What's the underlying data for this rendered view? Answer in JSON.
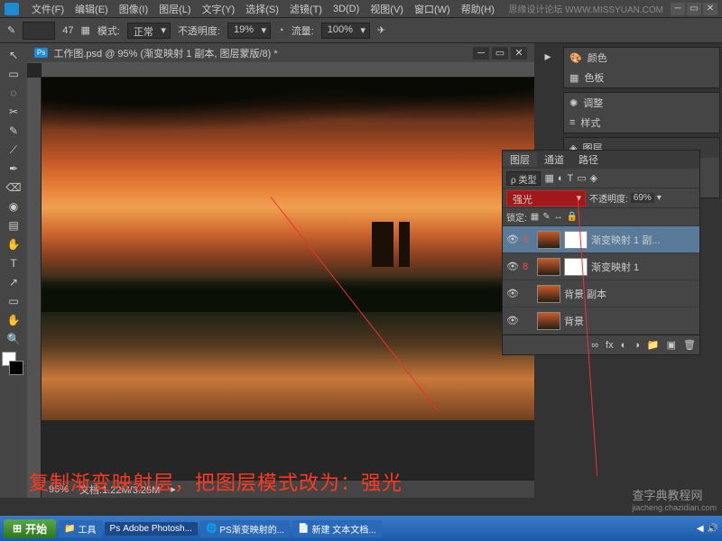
{
  "menubar": {
    "items": [
      "文件(F)",
      "编辑(E)",
      "图像(I)",
      "图层(L)",
      "文字(Y)",
      "选择(S)",
      "滤镜(T)",
      "3D(D)",
      "视图(V)",
      "窗口(W)",
      "帮助(H)"
    ],
    "brand": "思缘设计论坛  WWW.MISSYUAN.COM"
  },
  "optionbar": {
    "brush_size": "47",
    "mode_label": "模式:",
    "mode_value": "正常",
    "opacity_label": "不透明度:",
    "opacity_value": "19%",
    "flow_label": "流量:",
    "flow_value": "100%"
  },
  "document": {
    "title": "工作图.psd @ 95% (渐变映射 1 副本, 图层蒙版/8) *",
    "zoom": "95%",
    "filesize": "文档:1.22M/3.25M"
  },
  "right_panels": {
    "items": [
      {
        "icon": "🎨",
        "label": "颜色"
      },
      {
        "icon": "▦",
        "label": "色板"
      },
      {
        "icon": "✺",
        "label": "调整"
      },
      {
        "icon": "≡",
        "label": "样式"
      },
      {
        "icon": "◈",
        "label": "图层"
      },
      {
        "icon": "◐",
        "label": "通道"
      },
      {
        "icon": "↯",
        "label": "路径"
      }
    ]
  },
  "layers_panel": {
    "tabs": [
      "图层",
      "通道",
      "路径"
    ],
    "kind_label": "ρ 类型",
    "blend_mode": "强光",
    "opacity_label": "不透明度:",
    "opacity_value": "69%",
    "lock_label": "锁定:",
    "layers": [
      {
        "name": "渐变映射 1 副...",
        "has_mask": true,
        "linked": true,
        "active": true
      },
      {
        "name": "渐变映射 1",
        "has_mask": true,
        "linked": true,
        "active": false
      },
      {
        "name": "背景 副本",
        "has_mask": false,
        "linked": false,
        "active": false
      },
      {
        "name": "背景",
        "has_mask": false,
        "linked": false,
        "active": false
      }
    ]
  },
  "annotation": "复制渐变映射层，把图层模式改为：强光",
  "taskbar": {
    "start": "开始",
    "items": [
      "工具",
      "Adobe Photosh...",
      "PS渐变映射的...",
      "新建 文本文档..."
    ],
    "active_index": 1
  },
  "watermark": {
    "main": "查字典教程网",
    "sub": "jiacheng.chazidian.com"
  },
  "tool_icons": [
    "↖",
    "▭",
    "◌",
    "✂",
    "✎",
    "⟋",
    "✒",
    "⌫",
    "◉",
    "▤",
    "✋",
    "T",
    "↗",
    "▭",
    "◔",
    "⬚",
    "✋",
    "🔍"
  ]
}
